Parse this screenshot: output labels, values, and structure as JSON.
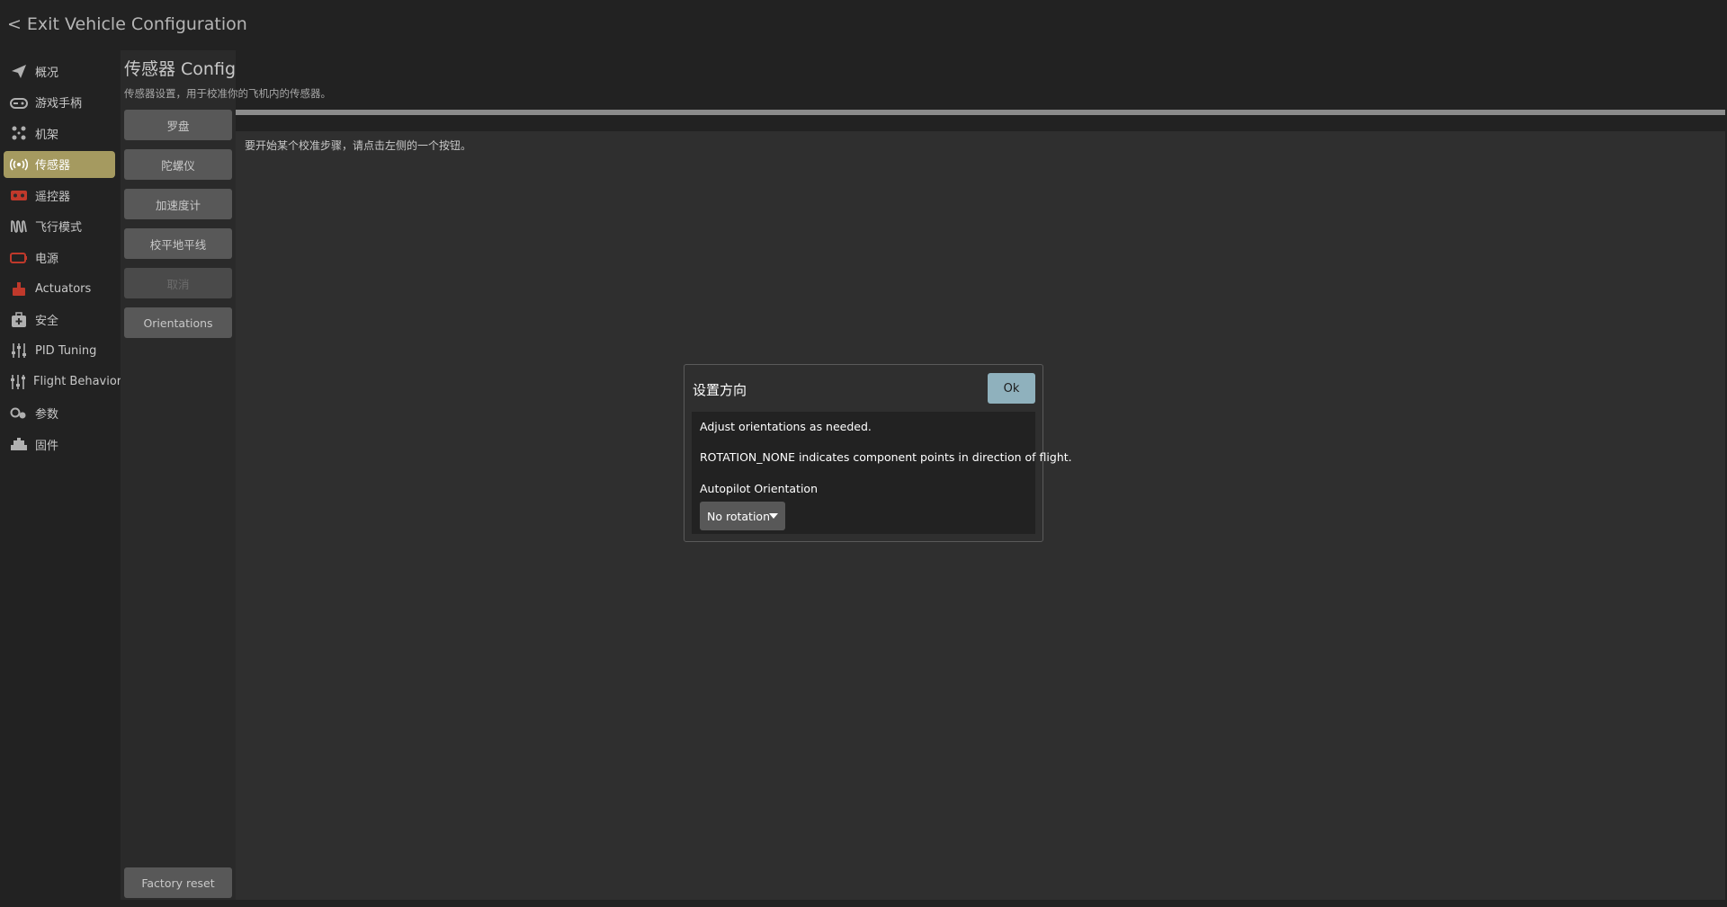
{
  "header": {
    "exit_chevron": "<",
    "exit_label": "Exit Vehicle Configuration"
  },
  "nav": {
    "items": [
      {
        "label": "概况",
        "icon": "paper-plane-icon",
        "active": false
      },
      {
        "label": "游戏手柄",
        "icon": "gamepad-icon",
        "active": false
      },
      {
        "label": "机架",
        "icon": "airframe-icon",
        "active": false
      },
      {
        "label": "传感器",
        "icon": "sensors-icon",
        "active": true
      },
      {
        "label": "遥控器",
        "icon": "radio-icon",
        "active": false
      },
      {
        "label": "飞行模式",
        "icon": "flight-modes-icon",
        "active": false
      },
      {
        "label": "电源",
        "icon": "battery-icon",
        "active": false
      },
      {
        "label": "Actuators",
        "icon": "actuators-icon",
        "active": false
      },
      {
        "label": "安全",
        "icon": "safety-icon",
        "active": false
      },
      {
        "label": "PID Tuning",
        "icon": "tuning-sliders-icon",
        "active": false
      },
      {
        "label": "Flight Behavior",
        "icon": "behavior-sliders-icon",
        "active": false
      },
      {
        "label": "参数",
        "icon": "parameters-icon",
        "active": false
      },
      {
        "label": "固件",
        "icon": "firmware-icon",
        "active": false
      }
    ]
  },
  "page": {
    "title": "传感器 Config",
    "description": "传感器设置，用于校准你的飞机内的传感器。",
    "hint": "要开始某个校准步骤，请点击左侧的一个按钮。",
    "progress": 1.0
  },
  "calibration_buttons": [
    {
      "label": "罗盘",
      "enabled": true
    },
    {
      "label": "陀螺仪",
      "enabled": true
    },
    {
      "label": "加速度计",
      "enabled": true
    },
    {
      "label": "校平地平线",
      "enabled": true
    },
    {
      "label": "取消",
      "enabled": false
    },
    {
      "label": "Orientations",
      "enabled": true
    }
  ],
  "factory_reset_label": "Factory reset",
  "dialog": {
    "title": "设置方向",
    "ok_label": "Ok",
    "line1": "Adjust orientations as needed.",
    "line2": "ROTATION_NONE indicates component points in direction of flight.",
    "orientation_label": "Autopilot Orientation",
    "orientation_value": "No rotation"
  },
  "colors": {
    "background": "#222222",
    "active_nav": "#a59a60",
    "button": "#585858",
    "ok_button": "#8fb1bd",
    "icon_red": "#c0392b",
    "icon_gray": "#b0b0b0"
  }
}
